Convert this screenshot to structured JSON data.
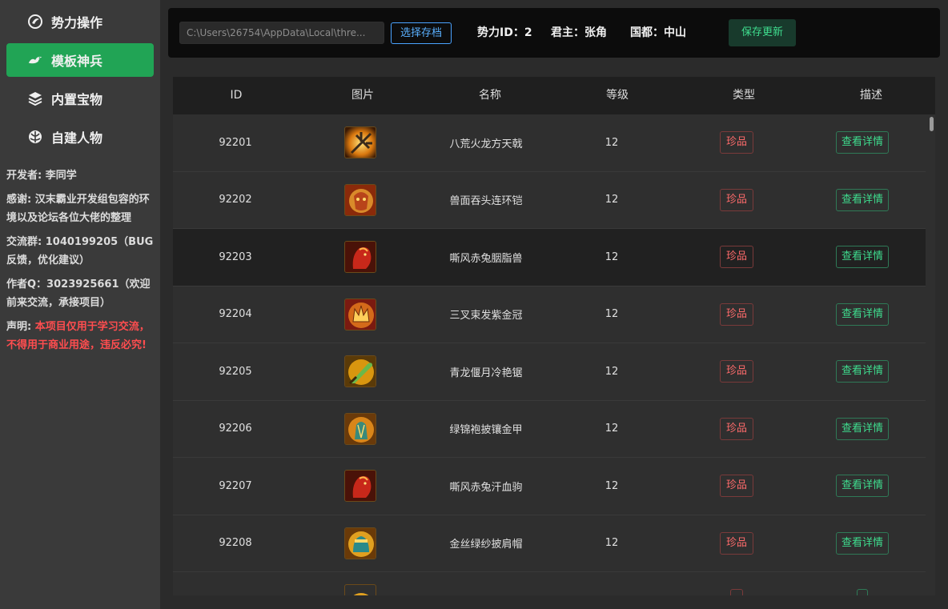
{
  "sidebar": {
    "items": [
      {
        "label": "势力操作",
        "icon": "orb-icon",
        "active": false
      },
      {
        "label": "模板神兵",
        "icon": "dragon-icon",
        "active": true
      },
      {
        "label": "内置宝物",
        "icon": "layers-icon",
        "active": false
      },
      {
        "label": "自建人物",
        "icon": "emblem-icon",
        "active": false
      }
    ],
    "developer": "开发者: 李同学",
    "thanks": "感谢: 汉末霸业开发组包容的环境以及论坛各位大佬的整理",
    "group": "交流群:  1040199205（BUG反馈，优化建议）",
    "author": "作者Q：3023925661（欢迎前来交流，承接项目）",
    "declaration_label": "声明: ",
    "declaration_text": "本项目仅用于学习交流，不得用于商业用途，违反必究!"
  },
  "topbar": {
    "path_value": "C:\\Users\\26754\\AppData\\Local\\thre...",
    "select_label": "选择存档",
    "force_id": "势力ID：2",
    "lord": "君主：张角",
    "capital": "国都：中山",
    "save_label": "保存更新"
  },
  "table": {
    "headers": [
      "ID",
      "图片",
      "名称",
      "等级",
      "类型",
      "描述"
    ],
    "rows": [
      {
        "id": "92201",
        "name": "八荒火龙方天戟",
        "level": "12",
        "type": "珍品",
        "action": "查看详情",
        "img": "halberd-icon",
        "hover": false
      },
      {
        "id": "92202",
        "name": "兽面吞头连环铠",
        "level": "12",
        "type": "珍品",
        "action": "查看详情",
        "img": "armor-icon",
        "hover": false
      },
      {
        "id": "92203",
        "name": "嘶风赤兔胭脂兽",
        "level": "12",
        "type": "珍品",
        "action": "查看详情",
        "img": "horse-icon",
        "hover": true
      },
      {
        "id": "92204",
        "name": "三叉束发紫金冠",
        "level": "12",
        "type": "珍品",
        "action": "查看详情",
        "img": "crown-icon",
        "hover": false
      },
      {
        "id": "92205",
        "name": "青龙偃月冷艳锯",
        "level": "12",
        "type": "珍品",
        "action": "查看详情",
        "img": "blade-icon",
        "hover": false
      },
      {
        "id": "92206",
        "name": "绿锦袍披镶金甲",
        "level": "12",
        "type": "珍品",
        "action": "查看详情",
        "img": "robe-icon",
        "hover": false
      },
      {
        "id": "92207",
        "name": "嘶风赤兔汗血驹",
        "level": "12",
        "type": "珍品",
        "action": "查看详情",
        "img": "horse-icon",
        "hover": false
      },
      {
        "id": "92208",
        "name": "金丝绿纱披肩帽",
        "level": "12",
        "type": "珍品",
        "action": "查看详情",
        "img": "hat-icon",
        "hover": false
      },
      {
        "id": "",
        "name": "",
        "level": "",
        "type": "",
        "action": "",
        "img": "partial-icon",
        "hover": false
      }
    ]
  },
  "colors": {
    "accent_green": "#21a455",
    "badge_red": "#ff6b6b",
    "detail_green": "#3fdc8e",
    "select_blue": "#5ab0ff"
  }
}
